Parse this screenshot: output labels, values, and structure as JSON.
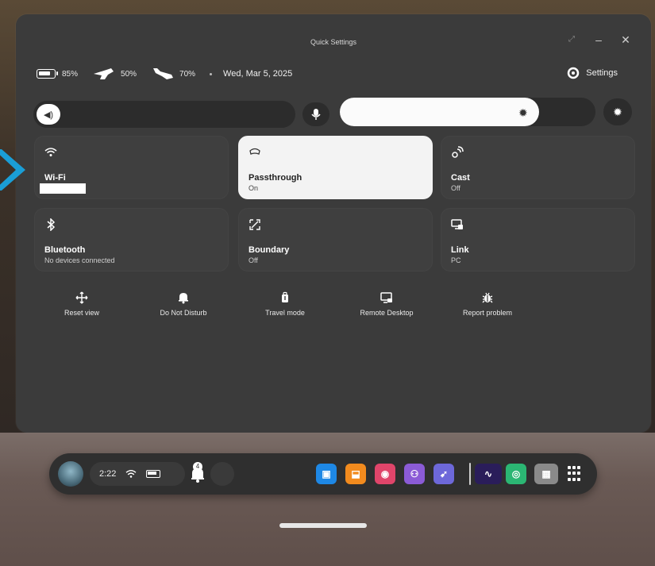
{
  "window": {
    "title": "Quick Settings"
  },
  "status": {
    "headset_battery": "85%",
    "left_controller_battery": "50%",
    "right_controller_battery": "70%",
    "date": "Wed, Mar 5, 2025",
    "settings_label": "Settings"
  },
  "sliders": {
    "volume_level": 0.0,
    "brightness_level": 0.78
  },
  "tiles": [
    {
      "name": "Wi-Fi",
      "sub": "",
      "icon": "wifi-icon",
      "active": false
    },
    {
      "name": "Passthrough",
      "sub": "On",
      "icon": "passthrough-icon",
      "active": true
    },
    {
      "name": "Cast",
      "sub": "Off",
      "icon": "cast-icon",
      "active": false
    },
    {
      "name": "Bluetooth",
      "sub": "No devices connected",
      "icon": "bluetooth-icon",
      "active": false
    },
    {
      "name": "Boundary",
      "sub": "Off",
      "icon": "boundary-icon",
      "active": false
    },
    {
      "name": "Link",
      "sub": "PC",
      "icon": "link-icon",
      "active": false
    }
  ],
  "quick_actions": [
    {
      "label": "Reset view",
      "icon": "reset-view-icon"
    },
    {
      "label": "Do Not Disturb",
      "icon": "bell-icon"
    },
    {
      "label": "Travel mode",
      "icon": "luggage-icon"
    },
    {
      "label": "Remote Desktop",
      "icon": "remote-desktop-icon"
    },
    {
      "label": "Report problem",
      "icon": "bug-icon"
    }
  ],
  "taskbar": {
    "time": "2:22",
    "notification_count": "4",
    "apps": [
      {
        "icon": "store-icon",
        "color": "#1e88e5"
      },
      {
        "icon": "shopping-bag-icon",
        "color": "#f28b1e"
      },
      {
        "icon": "camera-icon",
        "color": "#e0456a"
      },
      {
        "icon": "people-icon",
        "color": "#8b5bd6"
      },
      {
        "icon": "explore-icon",
        "color": "#6d68d9"
      },
      {
        "icon": "audio-app-icon",
        "color": "#2a1d5a"
      },
      {
        "icon": "green-app-icon",
        "color": "#2bb673"
      },
      {
        "icon": "game-app-icon",
        "color": "#8a8a8a"
      }
    ]
  },
  "colors": {
    "panel": "#3b3b3b",
    "tile": "#3f3f3f",
    "active_tile": "#f3f3f3",
    "accent_arrow": "#1a9ed6"
  }
}
